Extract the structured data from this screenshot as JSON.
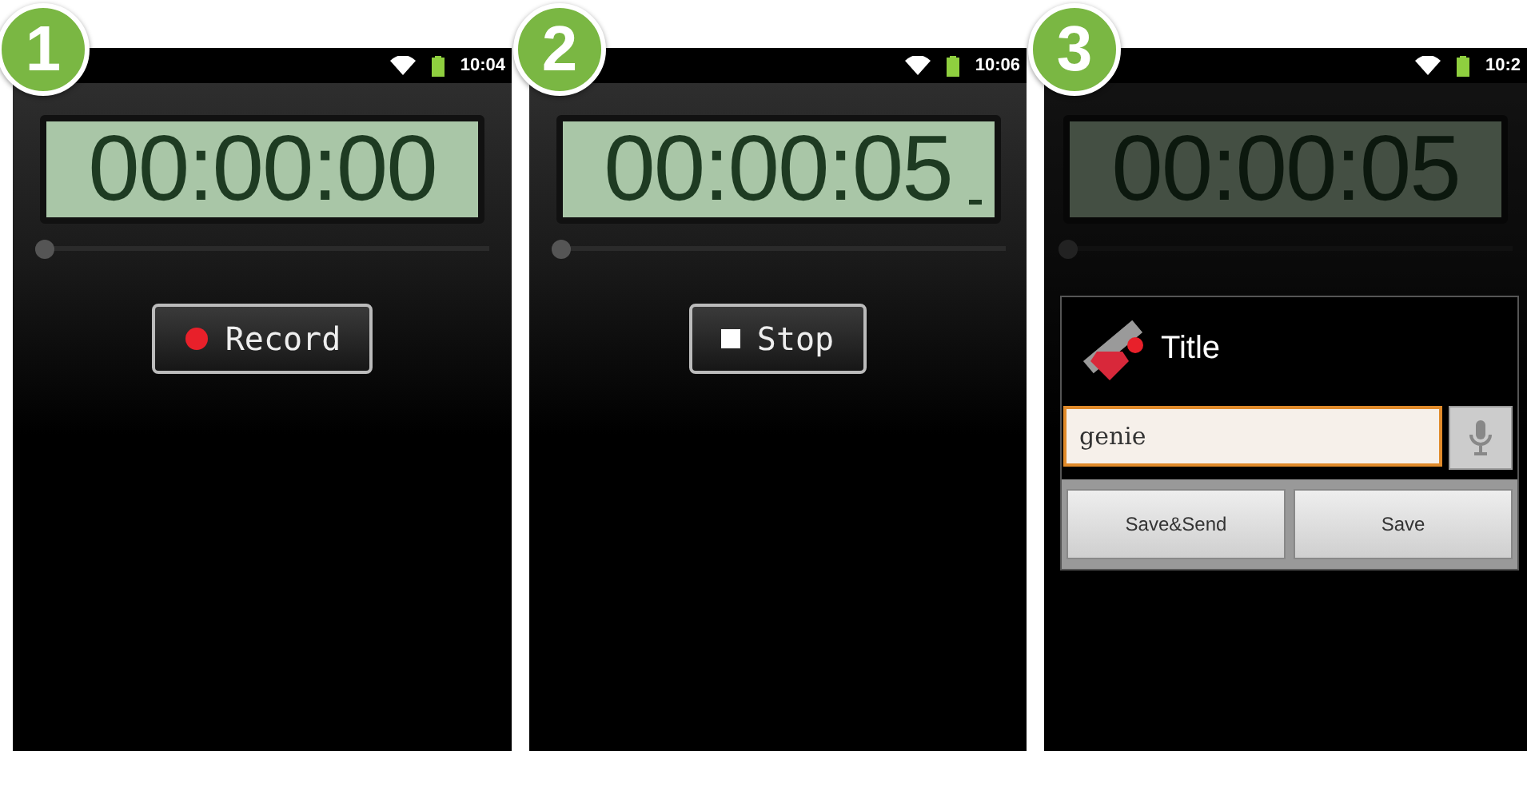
{
  "steps": [
    {
      "number": "1",
      "status_time": "10:04",
      "timer": "00:00:00",
      "cursor": false,
      "dimmed": false,
      "progress": {
        "level": 0
      },
      "button": {
        "kind": "record",
        "label": "Record"
      }
    },
    {
      "number": "2",
      "status_time": "10:06",
      "timer": "00:00:05",
      "cursor": true,
      "dimmed": false,
      "progress": {
        "level": 0
      },
      "button": {
        "kind": "stop",
        "label": "Stop"
      }
    },
    {
      "number": "3",
      "status_time": "10:2",
      "timer": "00:00:05",
      "cursor": false,
      "dimmed": true,
      "progress": {
        "level": 0
      },
      "dialog": {
        "title": "Title",
        "input_value": "genie",
        "buttons": [
          "Save&Send",
          "Save"
        ]
      }
    }
  ]
}
